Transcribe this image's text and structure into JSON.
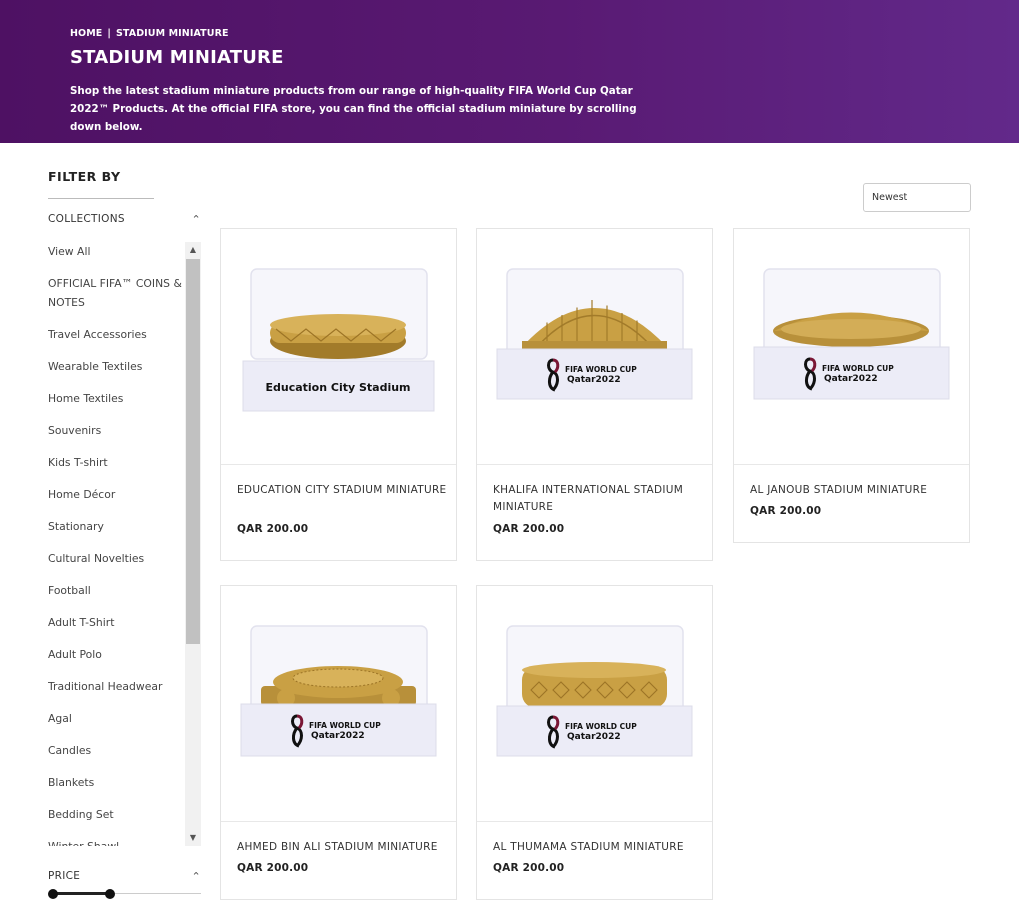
{
  "breadcrumb": {
    "home": "HOME",
    "separator": "|",
    "current": "STADIUM MINIATURE"
  },
  "page": {
    "title": "STADIUM MINIATURE",
    "description": "Shop the latest stadium miniature products from our range of high-quality FIFA World Cup Qatar 2022™ Products. At the official FIFA store, you can find the official stadium miniature by scrolling down below."
  },
  "filter": {
    "title": "FILTER BY",
    "collections_label": "COLLECTIONS",
    "collections": [
      "View All",
      "OFFICIAL FIFA™ COINS & NOTES",
      "Travel Accessories",
      "Wearable Textiles",
      "Home Textiles",
      "Souvenirs",
      "Kids T-shirt",
      "Home Décor",
      "Stationary",
      "Cultural Novelties",
      "Football",
      "Adult T-Shirt",
      "Adult Polo",
      "Traditional Headwear",
      "Agal",
      "Candles",
      "Blankets",
      "Bedding Set",
      "Winter Shawl"
    ],
    "price_label": "PRICE",
    "price_slider": {
      "min_fraction": 0.0,
      "max_fraction": 0.4
    }
  },
  "sort": {
    "selected": "Newest"
  },
  "products": [
    {
      "name": "EDUCATION CITY STADIUM MINIATURE",
      "price": "QAR 200.00",
      "plaque_text": "Education City Stadium",
      "icon": "education-city-stadium-miniature-image"
    },
    {
      "name": "KHALIFA INTERNATIONAL STADIUM MINIATURE",
      "price": "QAR 200.00",
      "plaque_text": "FIFA WORLD CUP",
      "plaque_sub": "Qatar2022",
      "icon": "khalifa-stadium-miniature-image"
    },
    {
      "name": "AL JANOUB STADIUM MINIATURE",
      "price": "QAR 200.00",
      "plaque_text": "FIFA WORLD CUP",
      "plaque_sub": "Qatar2022",
      "icon": "al-janoub-stadium-miniature-image"
    },
    {
      "name": "AHMED BIN ALI STADIUM MINIATURE",
      "price": "QAR 200.00",
      "plaque_text": "FIFA WORLD CUP",
      "plaque_sub": "Qatar2022",
      "icon": "ahmed-bin-ali-stadium-miniature-image"
    },
    {
      "name": "AL THUMAMA STADIUM MINIATURE",
      "price": "QAR 200.00",
      "plaque_text": "FIFA WORLD CUP",
      "plaque_sub": "Qatar2022",
      "icon": "al-thumama-stadium-miniature-image"
    }
  ],
  "colors": {
    "banner": "#591a73",
    "gold": "#c9a044",
    "plaque": "#ececf7"
  }
}
